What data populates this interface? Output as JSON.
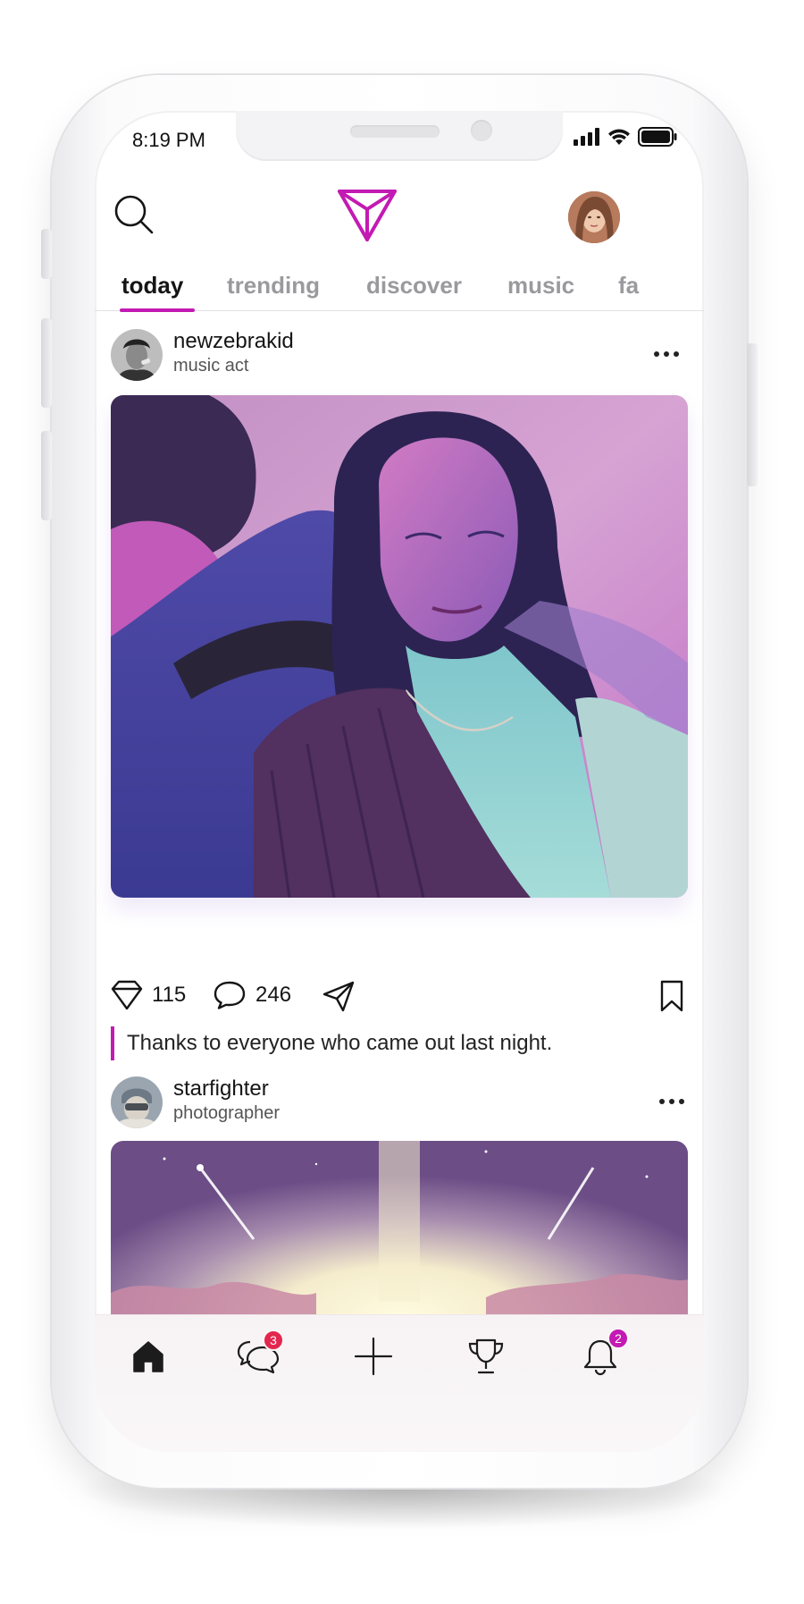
{
  "status_bar": {
    "time": "8:19 PM"
  },
  "header": {
    "search_icon": "search-icon",
    "logo_icon": "triangle-logo-icon",
    "avatar": "profile-avatar"
  },
  "tabs": [
    {
      "label": "today",
      "active": true
    },
    {
      "label": "trending",
      "active": false
    },
    {
      "label": "discover",
      "active": false
    },
    {
      "label": "music",
      "active": false
    },
    {
      "label": "fa",
      "active": false
    }
  ],
  "posts": [
    {
      "username": "newzebrakid",
      "role": "music act",
      "likes": "115",
      "comments": "246",
      "caption": "Thanks to everyone who came out last night."
    },
    {
      "username": "starfighter",
      "role": "photographer"
    }
  ],
  "bottom_nav": {
    "items": [
      "home-icon",
      "chat-icon",
      "plus-icon",
      "trophy-icon",
      "bell-icon"
    ],
    "chat_badge": "3",
    "bell_badge": "2"
  },
  "colors": {
    "accent": "#c31ab3",
    "badge_red": "#e3264e",
    "badge_magenta": "#c31ab3"
  }
}
